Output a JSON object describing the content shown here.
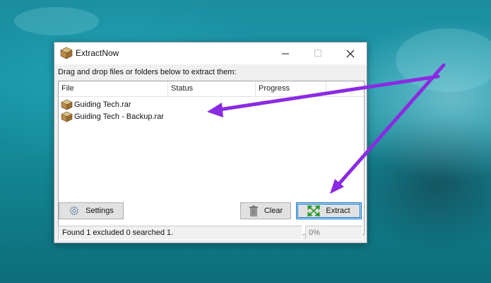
{
  "window": {
    "title": "ExtractNow",
    "app_icon": "package-box-icon",
    "controls": {
      "minimize": "minimize-icon",
      "maximize": "maximize-icon",
      "close": "close-icon"
    }
  },
  "hint": "Drag and drop files or folders below to extract them:",
  "list": {
    "columns": [
      "File",
      "Status",
      "Progress"
    ],
    "rows": [
      {
        "file": "Guiding Tech.rar",
        "status": "",
        "progress": "",
        "icon": "rar-archive-icon"
      },
      {
        "file": "Guiding Tech - Backup.rar",
        "status": "",
        "progress": "",
        "icon": "rar-archive-icon"
      }
    ]
  },
  "buttons": {
    "settings": {
      "label": "Settings",
      "icon": "gear-icon"
    },
    "clear": {
      "label": "Clear",
      "icon": "trash-icon"
    },
    "extract": {
      "label": "Extract",
      "icon": "expand-arrows-icon"
    }
  },
  "status": {
    "message": "Found 1 excluded 0 searched 1.",
    "progress": "0%"
  },
  "colors": {
    "annotation_arrow": "#8a2be2",
    "accent": "#0078d7"
  }
}
